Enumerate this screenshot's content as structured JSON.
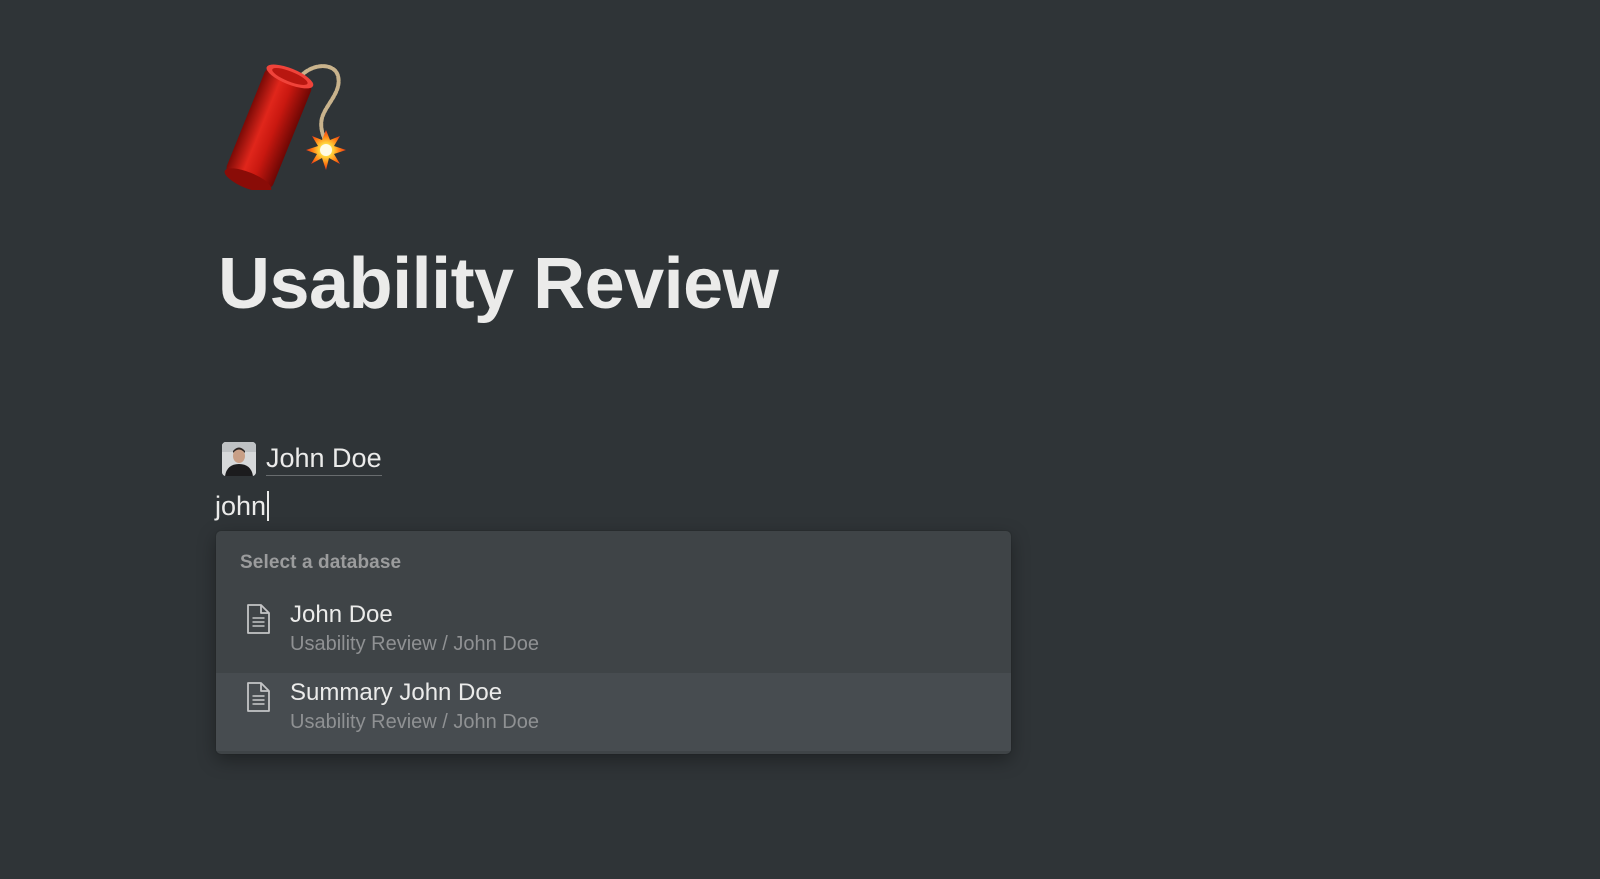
{
  "page": {
    "icon": "firecracker-emoji-icon",
    "title": "Usability Review"
  },
  "mention": {
    "avatar": "person-avatar",
    "name": "John Doe"
  },
  "editor": {
    "typed_text": "john"
  },
  "menu": {
    "header": "Select a database",
    "items": [
      {
        "icon": "document-icon",
        "title": "John Doe",
        "path": "Usability Review / John Doe",
        "selected": false
      },
      {
        "icon": "document-icon",
        "title": "Summary John Doe",
        "path": "Usability Review / John Doe",
        "selected": true
      }
    ]
  },
  "colors": {
    "background": "#2f3437",
    "menu_background": "#3f4447",
    "menu_selected": "#474c50",
    "text_primary": "#ebebea",
    "text_secondary": "#8f9193"
  }
}
